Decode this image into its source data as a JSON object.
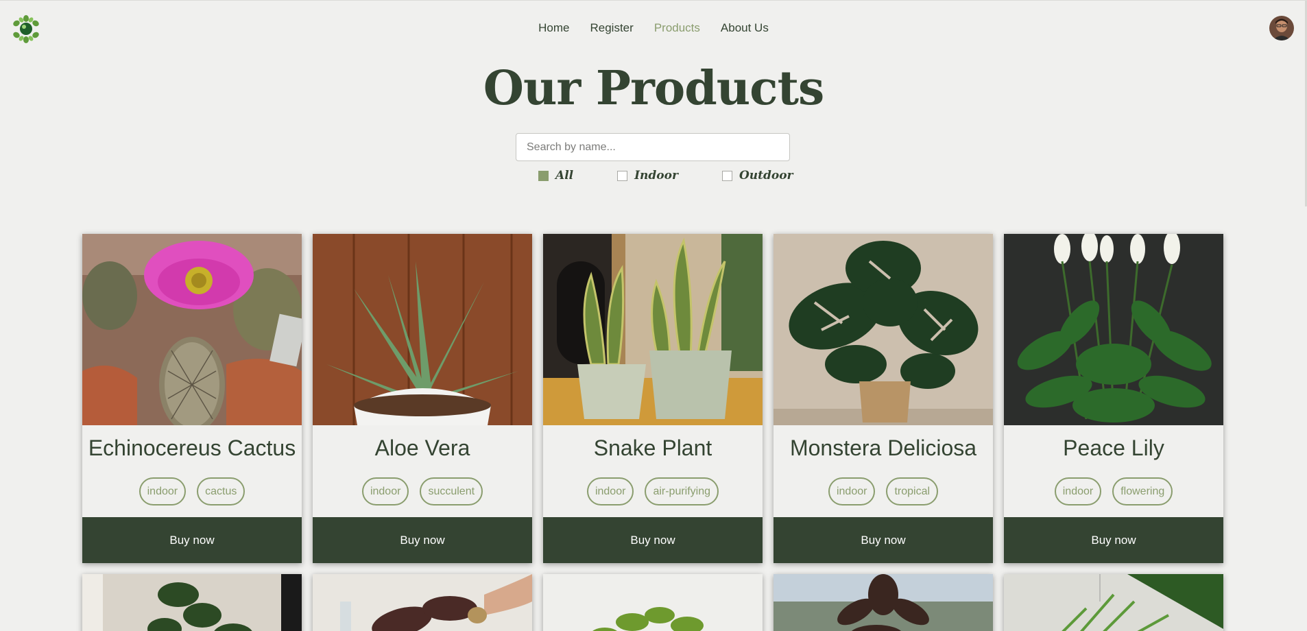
{
  "nav": {
    "items": [
      {
        "label": "Home",
        "active": false
      },
      {
        "label": "Register",
        "active": false
      },
      {
        "label": "Products",
        "active": true
      },
      {
        "label": "About Us",
        "active": false
      }
    ]
  },
  "page_title": "Our Products",
  "search": {
    "placeholder": "Search by name...",
    "value": ""
  },
  "filters": {
    "all": {
      "label": "All",
      "checked": true
    },
    "indoor": {
      "label": "Indoor",
      "checked": false
    },
    "outdoor": {
      "label": "Outdoor",
      "checked": false
    }
  },
  "products": [
    {
      "name": "Echinocereus Cactus",
      "tags": [
        "indoor",
        "cactus"
      ],
      "buy_label": "Buy now"
    },
    {
      "name": "Aloe Vera",
      "tags": [
        "indoor",
        "succulent"
      ],
      "buy_label": "Buy now"
    },
    {
      "name": "Snake Plant",
      "tags": [
        "indoor",
        "air-purifying"
      ],
      "buy_label": "Buy now"
    },
    {
      "name": "Monstera Deliciosa",
      "tags": [
        "indoor",
        "tropical"
      ],
      "buy_label": "Buy now"
    },
    {
      "name": "Peace Lily",
      "tags": [
        "indoor",
        "flowering"
      ],
      "buy_label": "Buy now"
    }
  ],
  "colors": {
    "primary_dark": "#344432",
    "accent_green": "#8a9d6e",
    "background": "#f0f0ee"
  },
  "icons": {
    "logo": "plant-globe-logo",
    "avatar": "user-avatar"
  }
}
